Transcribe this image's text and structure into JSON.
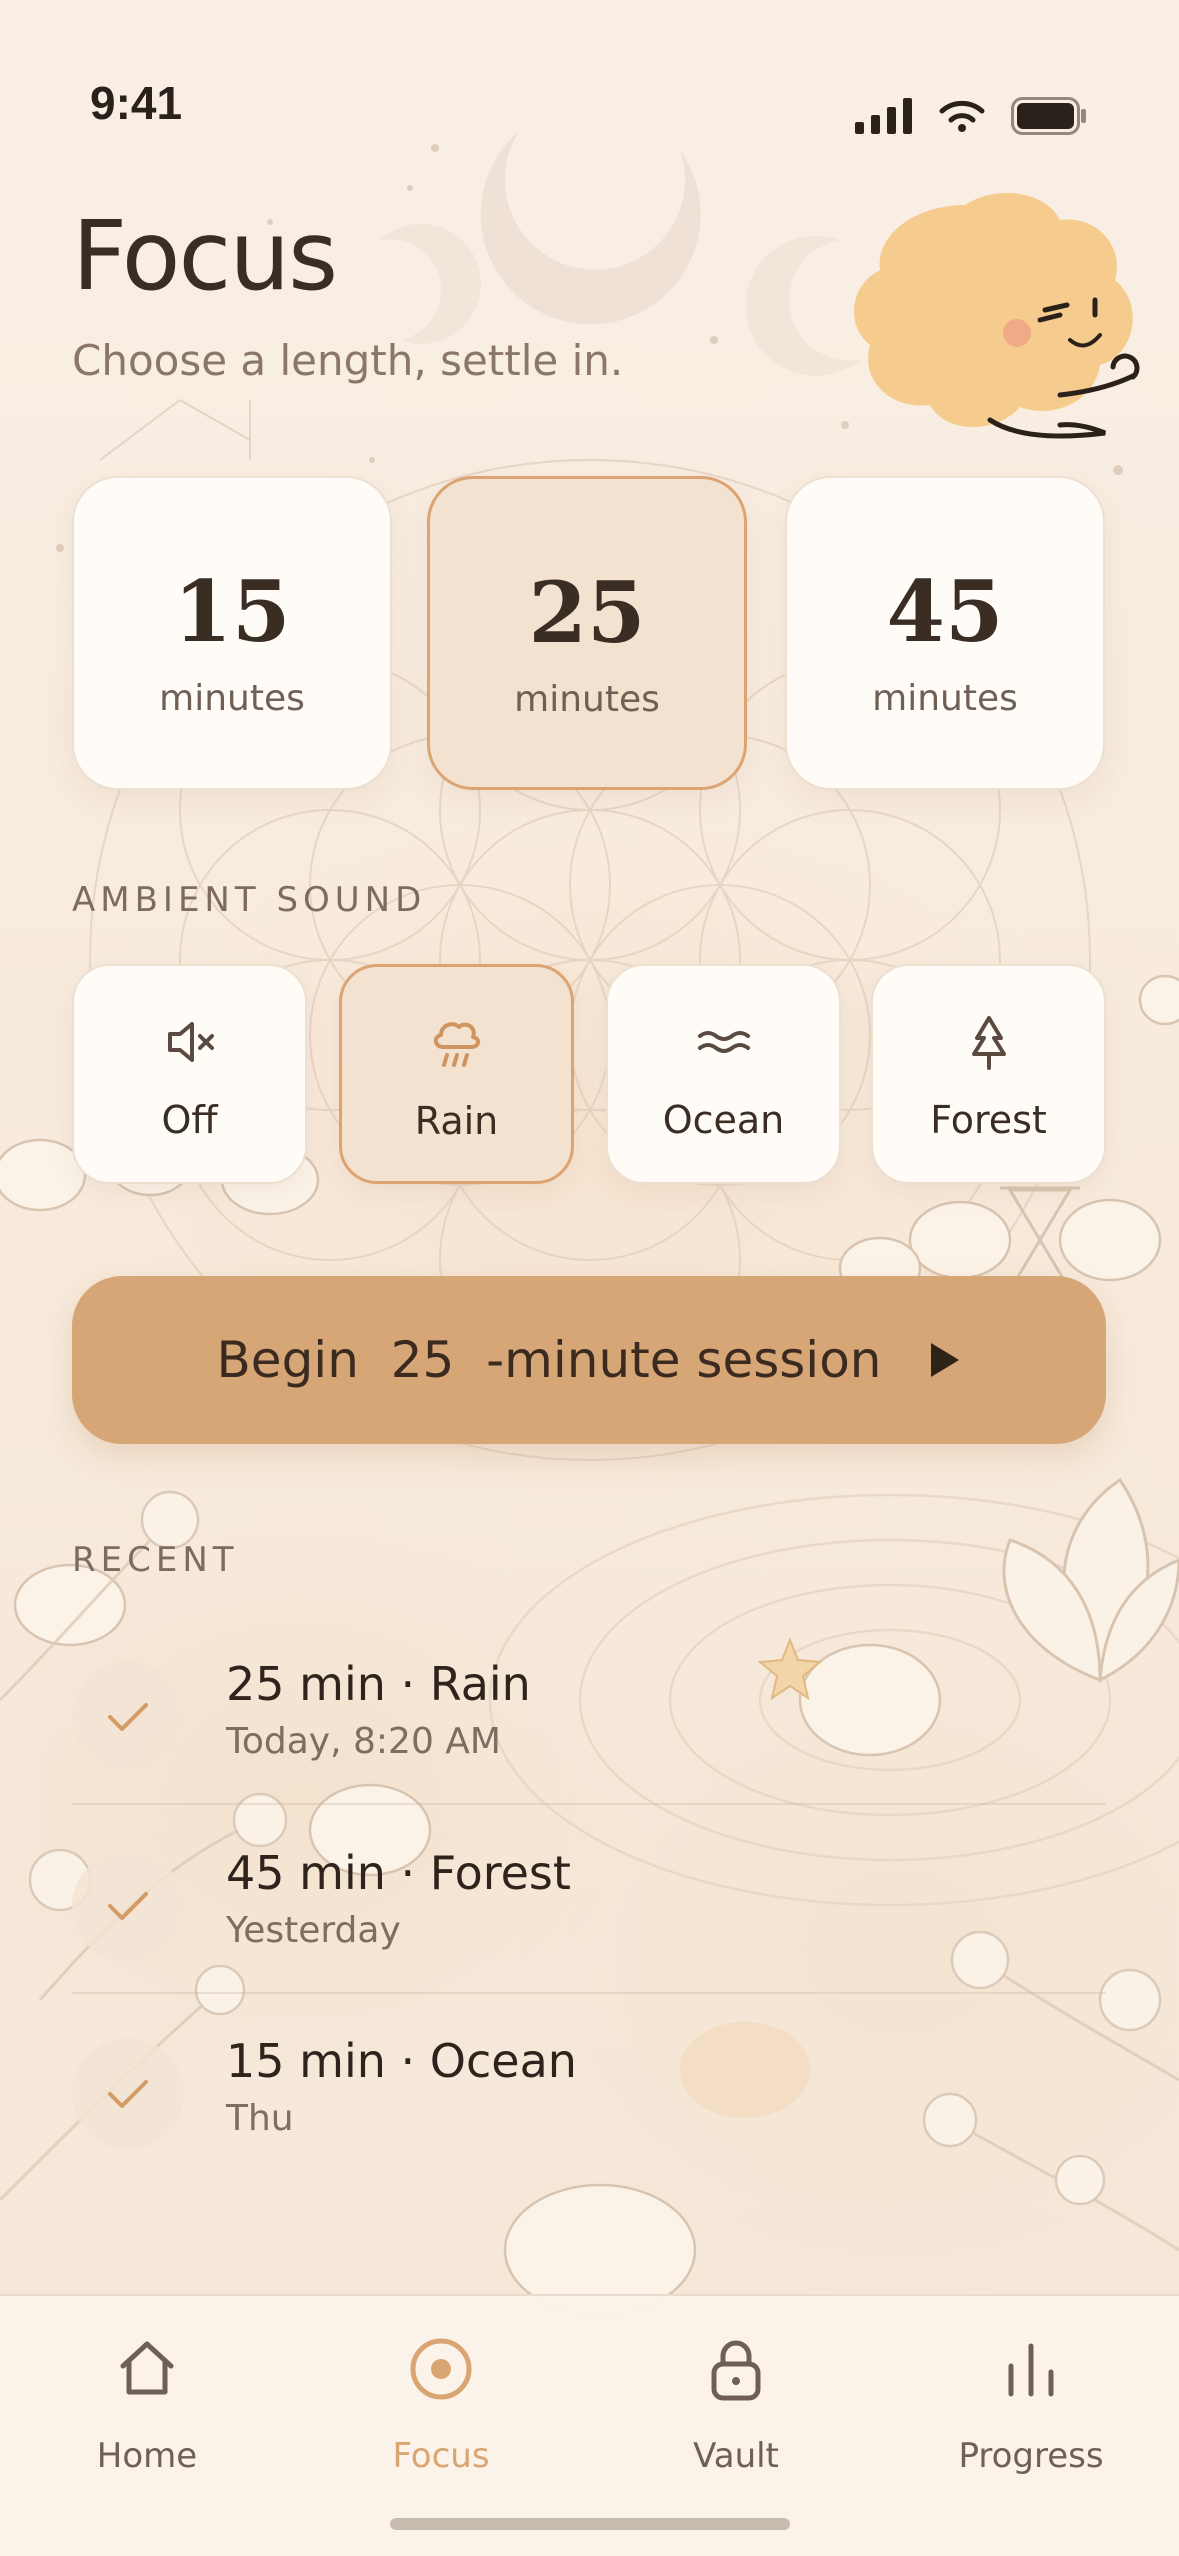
{
  "status": {
    "time": "9:41",
    "icons": [
      "signal-icon",
      "wifi-icon",
      "battery-icon"
    ]
  },
  "header": {
    "title": "Focus",
    "subtitle": "Choose a length, settle in."
  },
  "durations": {
    "unit": "minutes",
    "options": [
      {
        "value": "15",
        "selected": false
      },
      {
        "value": "25",
        "selected": true
      },
      {
        "value": "45",
        "selected": false
      }
    ]
  },
  "ambient": {
    "label": "AMBIENT SOUND",
    "options": [
      {
        "label": "Off",
        "icon": "mute-icon",
        "selected": false
      },
      {
        "label": "Rain",
        "icon": "rain-icon",
        "selected": true
      },
      {
        "label": "Ocean",
        "icon": "waves-icon",
        "selected": false
      },
      {
        "label": "Forest",
        "icon": "tree-icon",
        "selected": false
      }
    ]
  },
  "begin": {
    "prefix": "Begin",
    "minutes": "25",
    "suffix": "-minute session",
    "icon": "play-icon"
  },
  "recent": {
    "label": "RECENT",
    "items": [
      {
        "title": "25 min · Rain",
        "subtitle": "Today, 8:20 AM"
      },
      {
        "title": "45 min · Forest",
        "subtitle": "Yesterday"
      },
      {
        "title": "15 min · Ocean",
        "subtitle": "Thu"
      }
    ]
  },
  "tabs": [
    {
      "label": "Home",
      "icon": "home-icon",
      "active": false
    },
    {
      "label": "Focus",
      "icon": "focus-icon",
      "active": true
    },
    {
      "label": "Vault",
      "icon": "lock-icon",
      "active": false
    },
    {
      "label": "Progress",
      "icon": "bar-chart-icon",
      "active": false
    }
  ],
  "colors": {
    "background": "#f7ece0",
    "accent": "#d7a677",
    "accent_border": "#dba472",
    "selected_fill": "#f4e2d0",
    "text": "#3a2d24",
    "muted_text": "#7e6d60"
  }
}
